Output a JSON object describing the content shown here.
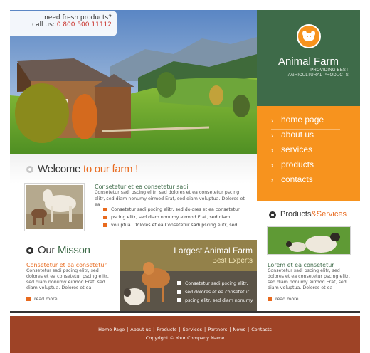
{
  "callout": {
    "line1": "need fresh products?",
    "line2_prefix": "call us:",
    "phone": "0 800 500 11112"
  },
  "brand": {
    "title": "Animal Farm",
    "subtitle_line1": "PROVIDING BEST",
    "subtitle_line2": "AGRICULTURAL PRODUCTS",
    "logo_icon": "animal-head-icon",
    "colors": {
      "green": "#3e6b49",
      "orange": "#f7931e",
      "rust": "#9e4326",
      "accent": "#e86a1e"
    }
  },
  "nav": {
    "items": [
      {
        "label": "home page"
      },
      {
        "label": "about us"
      },
      {
        "label": "services"
      },
      {
        "label": "products"
      },
      {
        "label": "contacts"
      }
    ],
    "arrow": "›"
  },
  "welcome": {
    "title_main": "Welcome",
    "title_accent": " to our farm !",
    "subtitle": "Consetetur et ea consetetur sadi",
    "body": "Consetetur sadi pscing elitr, sed dolores et ea consetetur pscing elitr, sed diam nonumy eirmod Erat, sed diam voluptua. Dolores et ea",
    "list": [
      "Consetetur sadi pscing elitr, sed dolores et ea consetetur",
      "pscing elitr, sed diam nonumy eirmod Erat, sed diam",
      "voluptua. Dolores et ea Consetetur sadi pscing elitr, sed"
    ]
  },
  "products": {
    "title_main": "Products",
    "title_accent": "&Services",
    "subtitle": "Lorem et ea consetetur",
    "body": "Consetetur sadi pscing elitr, sed dolores et ea consetetur pscing elitr, sed diam nonumy eirmod Erat, sed diam voluptua. Dolores et ea",
    "more": "read more"
  },
  "mission": {
    "title_main": "Our",
    "title_accent": " Misson",
    "subtitle": "Consetetur et ea consetetur",
    "body": "Consetetur sadi pscing elitr, sed dolores et ea consetetur pscing elitr, sed diam nonumy eirmod Erat, sed diam voluptua. Dolores et ea",
    "more": "read more"
  },
  "banner": {
    "title": "Largest Animal Farm",
    "subtitle": "Best Experts",
    "list": [
      "Consetetur sadi pscing elitr,",
      "sed dolores et ea consetetur",
      "pscing elitr, sed diam nonumy"
    ]
  },
  "footer": {
    "links": [
      "Home Page",
      "About us",
      "Products",
      "Services",
      "Partners",
      "News",
      "Contacts"
    ],
    "separator": "|",
    "copyright": "Copyright © Your Company Name"
  }
}
